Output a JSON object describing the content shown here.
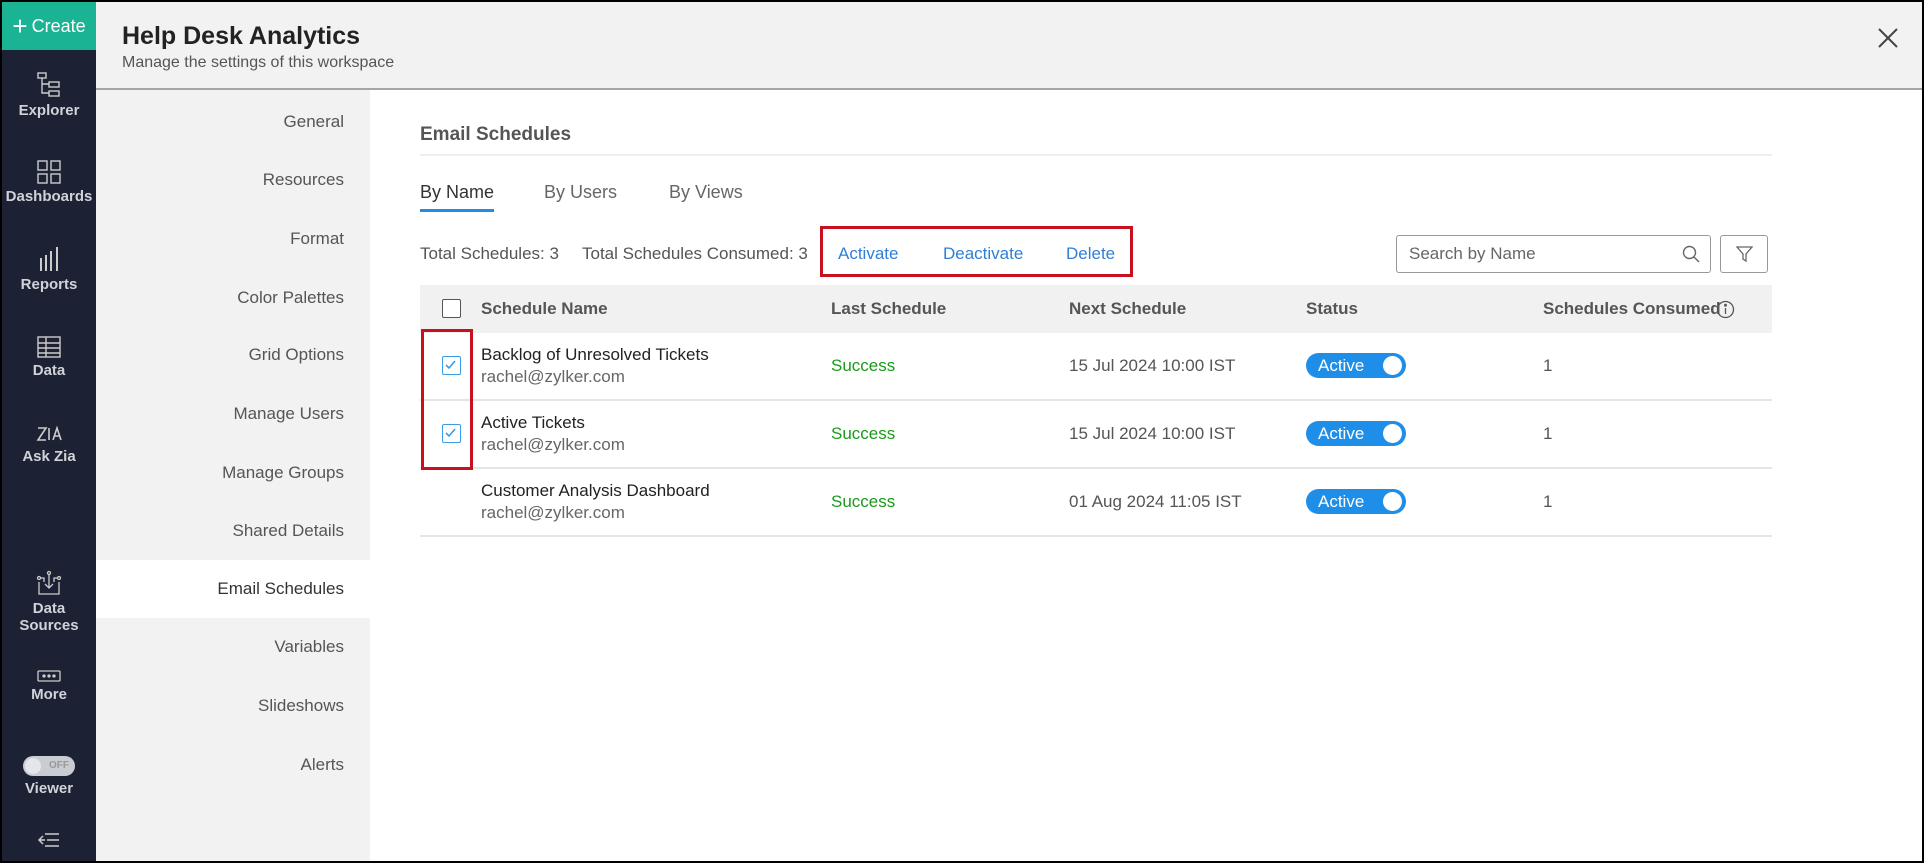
{
  "sidebar": {
    "create": "Create",
    "items": [
      {
        "label": "Explorer",
        "icon": "explorer-icon"
      },
      {
        "label": "Dashboards",
        "icon": "dashboards-icon"
      },
      {
        "label": "Reports",
        "icon": "reports-icon"
      },
      {
        "label": "Data",
        "icon": "data-icon"
      },
      {
        "label": "Ask Zia",
        "icon": "zia-icon"
      },
      {
        "label": "Data",
        "label2": "Sources",
        "icon": "data-sources-icon"
      },
      {
        "label": "More",
        "icon": "more-icon"
      }
    ],
    "viewer": {
      "label": "Viewer",
      "state": "OFF"
    }
  },
  "header": {
    "title": "Help Desk Analytics",
    "subtitle": "Manage the settings of this workspace"
  },
  "settings_nav": [
    "General",
    "Resources",
    "Format",
    "Color Palettes",
    "Grid Options",
    "Manage Users",
    "Manage Groups",
    "Shared Details",
    "Email Schedules",
    "Variables",
    "Slideshows",
    "Alerts"
  ],
  "main": {
    "title": "Email Schedules",
    "tabs": [
      "By Name",
      "By Users",
      "By Views"
    ],
    "total_schedules": "Total Schedules: 3",
    "total_consumed": "Total Schedules Consumed: 3",
    "actions": [
      "Activate",
      "Deactivate",
      "Delete"
    ],
    "search_placeholder": "Search by Name",
    "columns": [
      "Schedule Name",
      "Last Schedule",
      "Next Schedule",
      "Status",
      "Schedules Consumed"
    ],
    "rows": [
      {
        "name": "Backlog of Unresolved Tickets",
        "email": "rachel@zylker.com",
        "last": "Success",
        "next": "15 Jul 2024 10:00 IST",
        "status": "Active",
        "consumed": "1",
        "checked": true
      },
      {
        "name": "Active Tickets",
        "email": "rachel@zylker.com",
        "last": "Success",
        "next": "15 Jul 2024 10:00 IST",
        "status": "Active",
        "consumed": "1",
        "checked": true
      },
      {
        "name": "Customer Analysis Dashboard",
        "email": "rachel@zylker.com",
        "last": "Success",
        "next": "01 Aug 2024 11:05 IST",
        "status": "Active",
        "consumed": "1",
        "checked": false
      }
    ]
  }
}
